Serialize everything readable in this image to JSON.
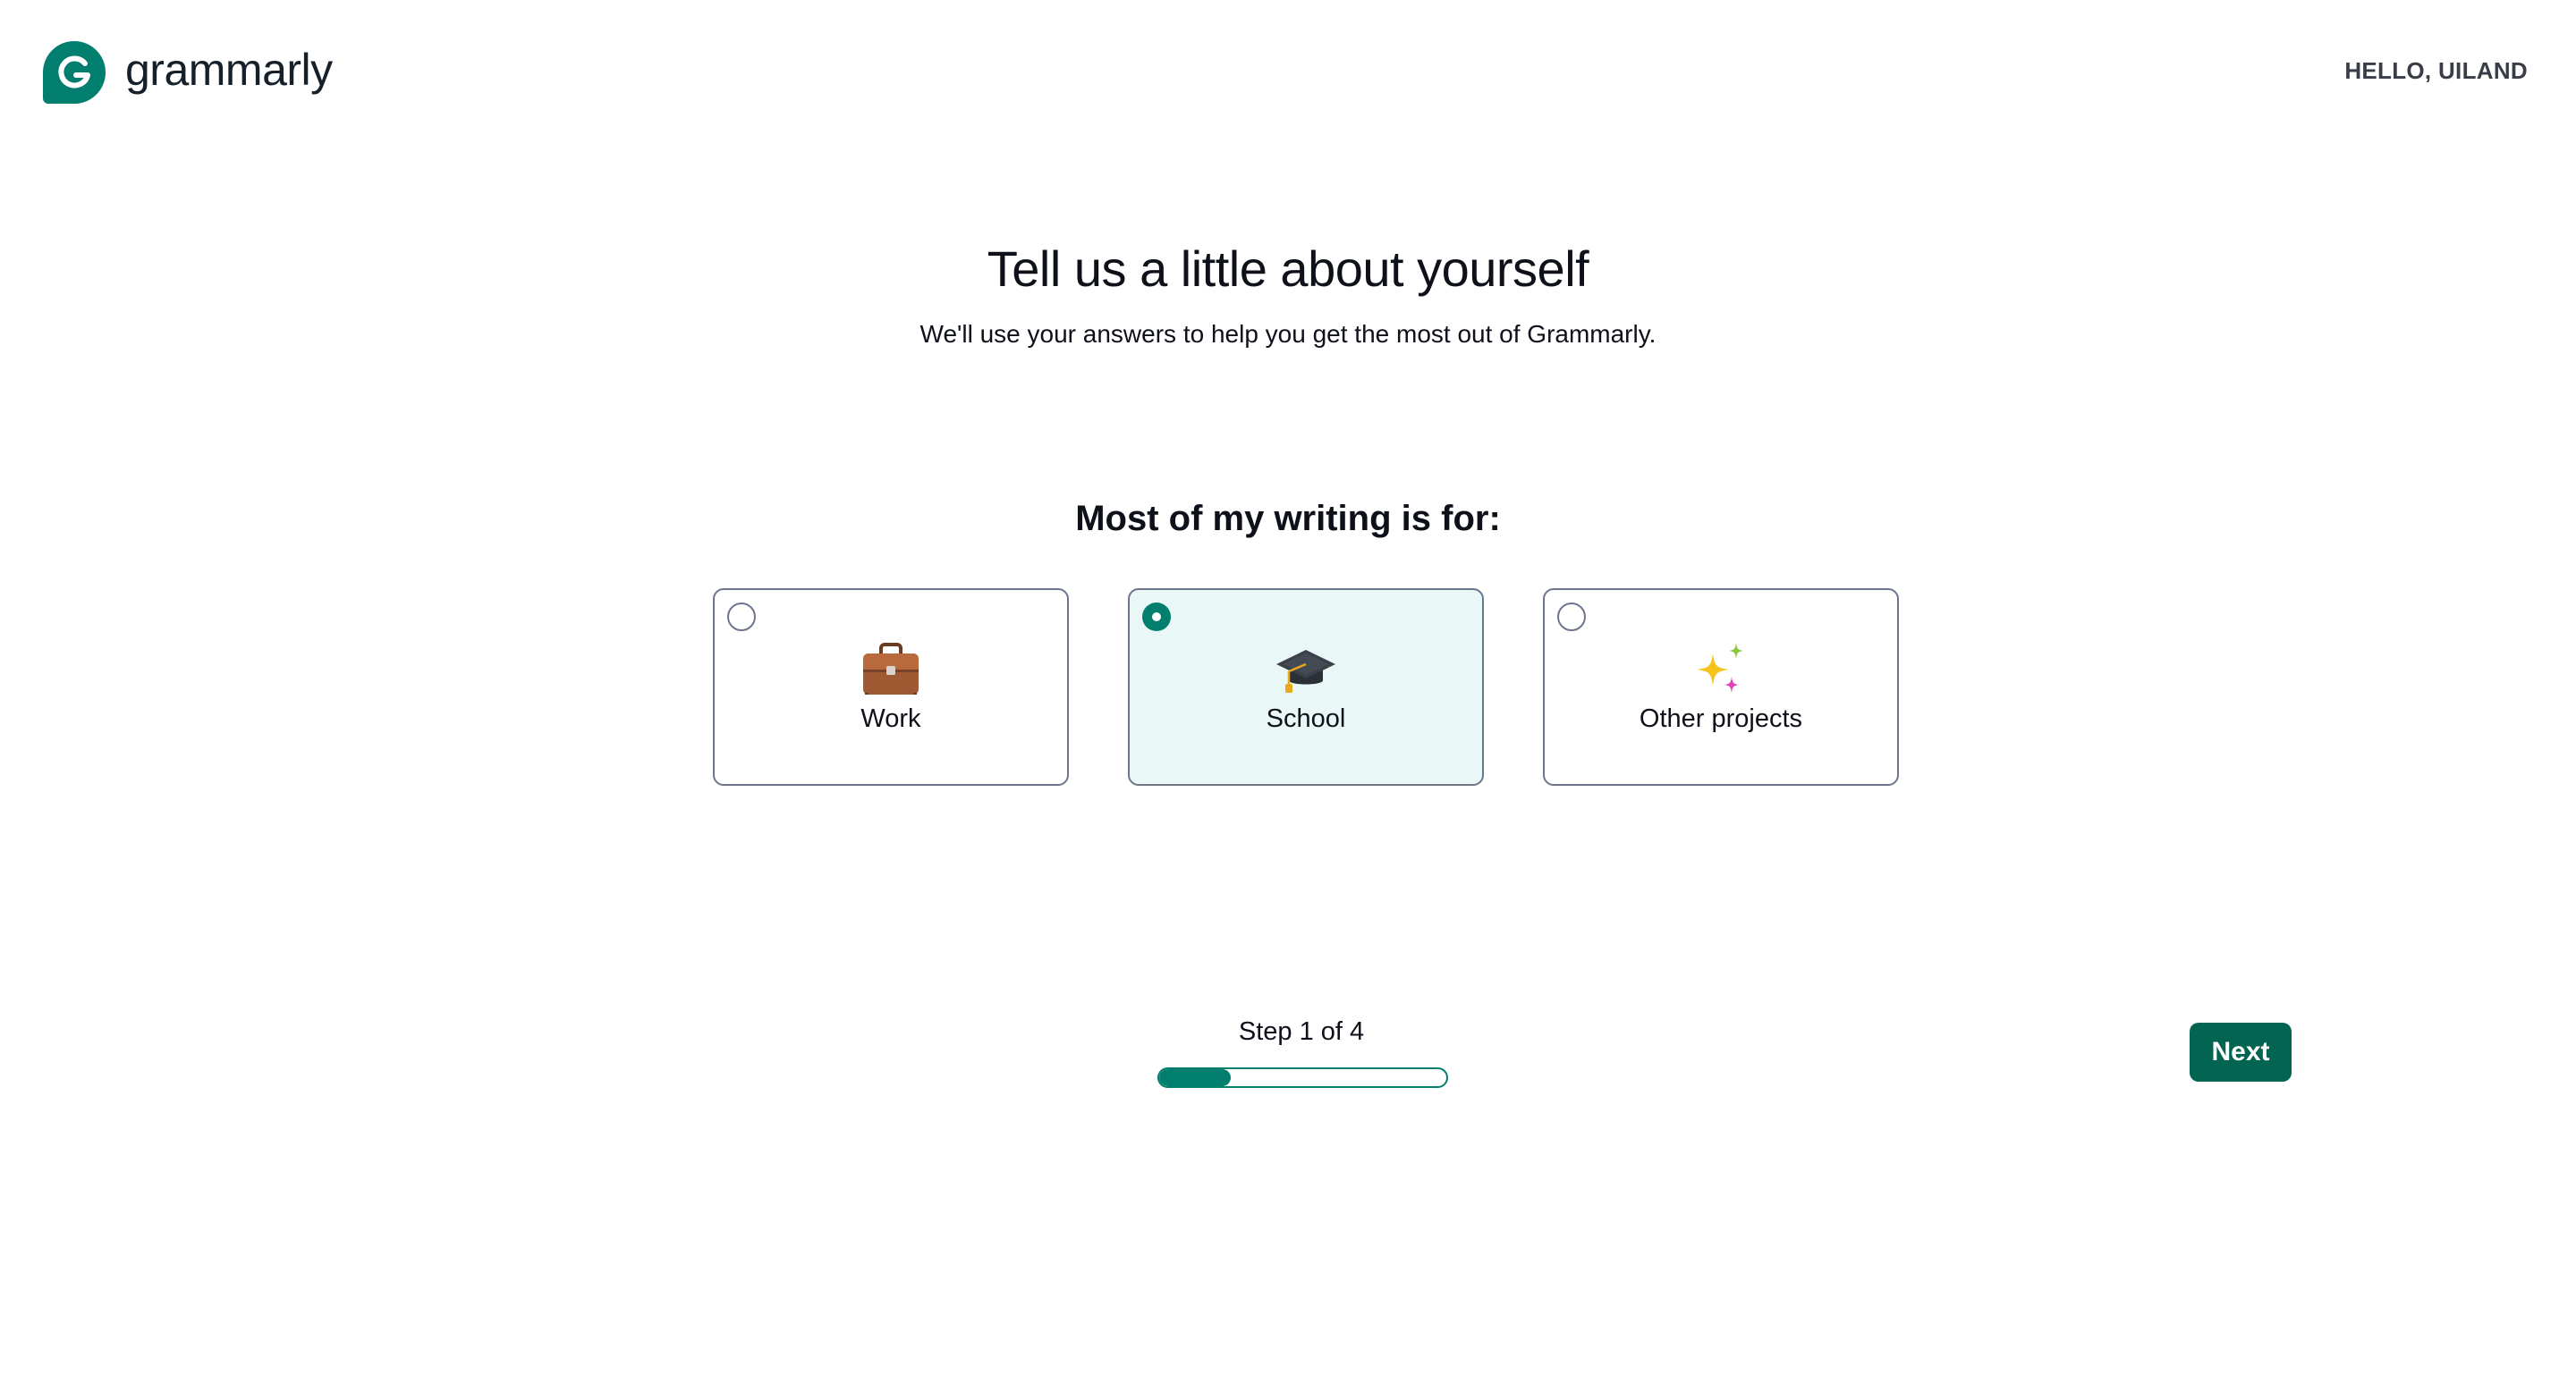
{
  "header": {
    "brand": "grammarly",
    "greeting": "HELLO, UILAND"
  },
  "main": {
    "title": "Tell us a little about yourself",
    "subtitle": "We'll use your answers to help you get the most out of Grammarly.",
    "question": "Most of my writing is for:",
    "options": [
      {
        "label": "Work",
        "icon": "briefcase-icon",
        "selected": false
      },
      {
        "label": "School",
        "icon": "graduation-cap-icon",
        "selected": true
      },
      {
        "label": "Other projects",
        "icon": "sparkles-icon",
        "selected": false
      }
    ]
  },
  "footer": {
    "step_text": "Step 1 of 4",
    "progress_fraction": 0.25,
    "next_label": "Next"
  },
  "colors": {
    "brand": "#027e6f",
    "button": "#026451",
    "selected_bg": "#e9f8f6",
    "border": "#6d758d"
  }
}
